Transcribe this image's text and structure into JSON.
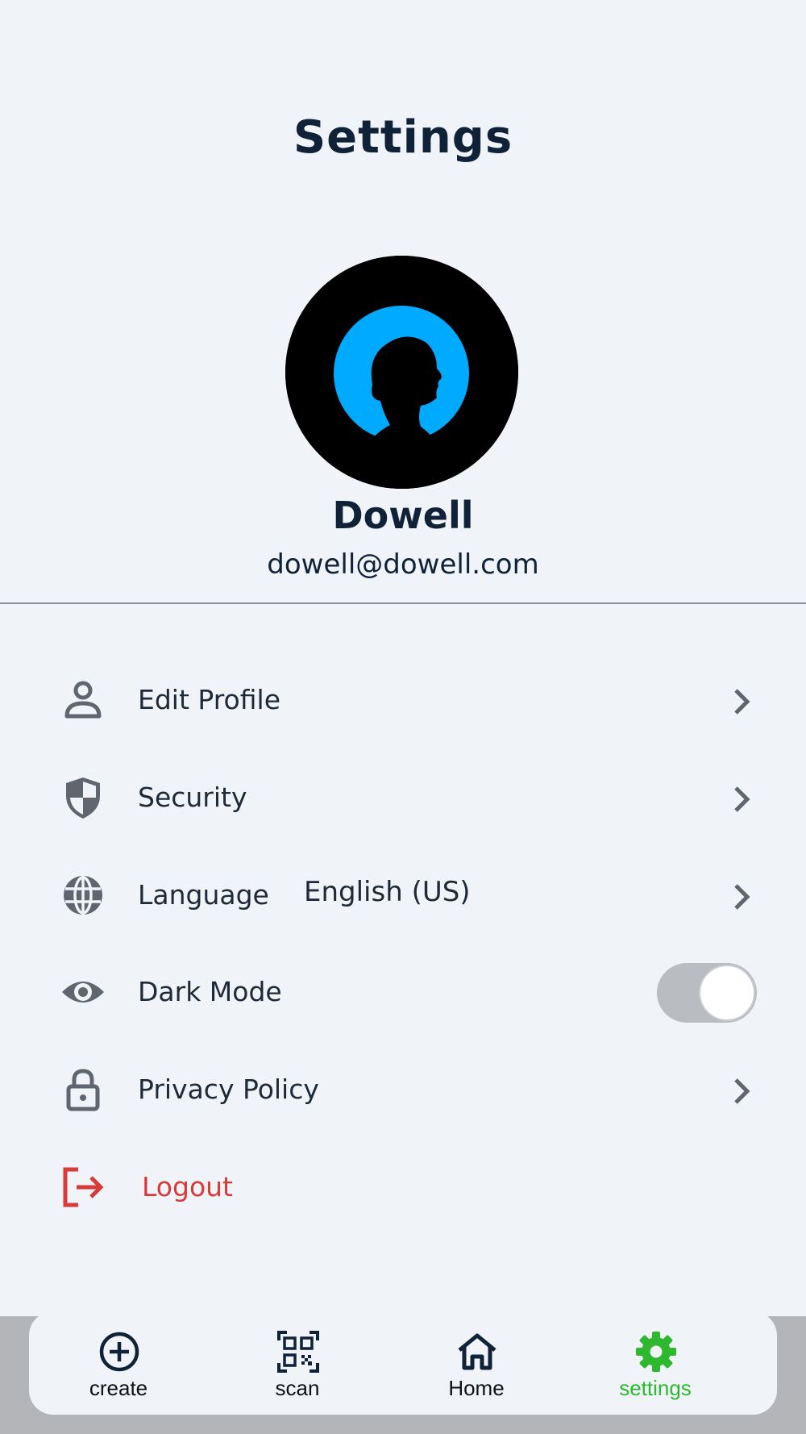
{
  "header": {
    "title": "Settings"
  },
  "profile": {
    "name": "Dowell",
    "email": "dowell@dowell.com"
  },
  "menu": {
    "edit_profile": {
      "label": "Edit Profile",
      "icon": "person-icon"
    },
    "security": {
      "label": "Security",
      "icon": "shield-icon"
    },
    "language": {
      "label": "Language",
      "value": "English (US)",
      "icon": "globe-icon"
    },
    "dark_mode": {
      "label": "Dark Mode",
      "icon": "eye-icon",
      "enabled": true
    },
    "privacy_policy": {
      "label": "Privacy Policy",
      "icon": "lock-icon"
    },
    "logout": {
      "label": "Logout",
      "icon": "logout-icon"
    }
  },
  "bottom_nav": {
    "items": [
      {
        "label": "create",
        "icon": "plus-circle-icon"
      },
      {
        "label": "scan",
        "icon": "qr-code-icon"
      },
      {
        "label": "Home",
        "icon": "home-icon"
      },
      {
        "label": "settings",
        "icon": "gear-icon",
        "active": true
      }
    ]
  },
  "colors": {
    "background": "#f0f3f8",
    "text": "#0f2238",
    "icon_gray": "#5f6670",
    "logout_red": "#d83a3a",
    "active_green": "#2db82d",
    "avatar_blue": "#00aaff"
  }
}
